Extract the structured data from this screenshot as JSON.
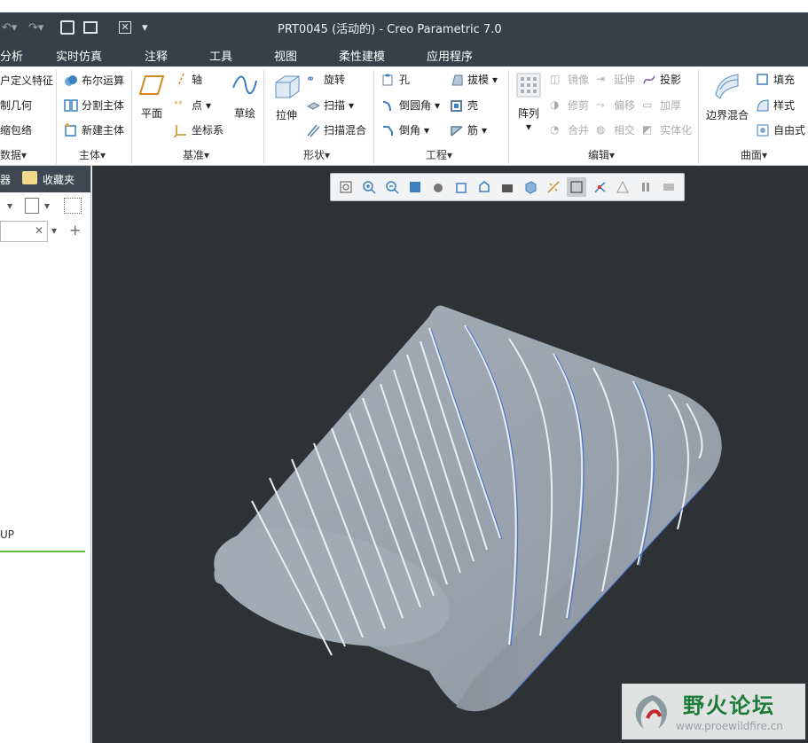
{
  "window": {
    "title": "PRT0045 (活动的) - Creo Parametric 7.0"
  },
  "menus": [
    "分析",
    "实时仿真",
    "注释",
    "工具",
    "视图",
    "柔性建模",
    "应用程序"
  ],
  "ribbon": {
    "main_body": {
      "items": [
        "户定义特征",
        "制几何",
        "缩包络"
      ],
      "group": "数据"
    },
    "body": {
      "items": [
        "布尔运算",
        "分割主体",
        "新建主体"
      ],
      "group": "主体"
    },
    "datum": {
      "plane": "平面",
      "axis": "轴",
      "point": "点",
      "csys": "坐标系",
      "sketch": "草绘",
      "group": "基准"
    },
    "shape": {
      "extrude": "拉伸",
      "revolve": "旋转",
      "sweep": "扫描",
      "swept_blend": "扫描混合",
      "group": "形状"
    },
    "engineering": {
      "hole": "孔",
      "round": "倒圆角",
      "chamfer": "倒角",
      "draft": "拔模",
      "shell": "壳",
      "rib": "筋",
      "group": "工程"
    },
    "edit": {
      "pattern": "阵列",
      "mirror": "镜像",
      "extend": "延伸",
      "project": "投影",
      "trim": "修剪",
      "offset": "偏移",
      "thicken": "加厚",
      "merge": "合并",
      "intersect": "相交",
      "solidify": "实体化",
      "group": "编辑"
    },
    "surface": {
      "boundary_blend": "边界混合",
      "fill": "填充",
      "style": "样式",
      "freestyle": "自由式",
      "group": "曲面"
    }
  },
  "left_panel": {
    "tab1": "器",
    "tab2": "收藏夹",
    "tree_item": "UP"
  },
  "watermark": {
    "cn": "野火论坛",
    "url": "www.proewildfire.cn"
  },
  "colors": {
    "chrome": "#374049",
    "viewport": "#2f3234",
    "model": "#9aa3ad",
    "edge": "#3f6fd6"
  }
}
